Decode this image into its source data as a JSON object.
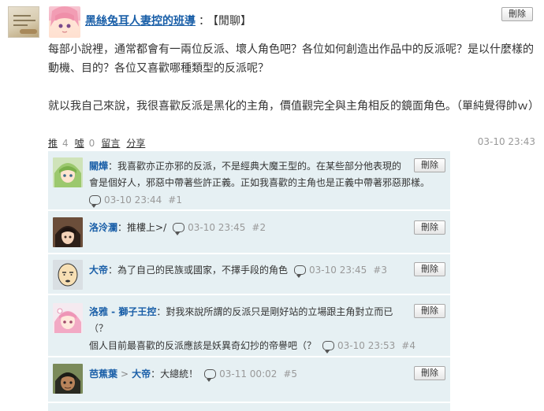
{
  "post": {
    "author": "黑絲兔耳人妻控的班導",
    "separator": "：",
    "topic": "【閒聊】",
    "delete_label": "刪除",
    "body": [
      "每部小說裡，通常都會有一兩位反派、壞人角色吧？各位如何創造出作品中的反派呢？是以什麼樣的動機、目的？各位又喜歡哪種類型的反派呢？",
      "就以我自己來說，我很喜歡反派是黑化的主角，價值觀完全與主角相反的鏡面角色。（單純覺得帥ｗ）"
    ],
    "actions": {
      "push_label": "推",
      "push_count": "4",
      "boo_label": "噓",
      "boo_count": "0",
      "reply_label": "留言",
      "share_label": "分享"
    },
    "time": "03-10 23:43"
  },
  "comments": [
    {
      "author": "關燁",
      "reply_to": "",
      "text_line1": "：我喜歡亦正亦邪的反派，不是經典大魔王型的。在某些部分他表現的",
      "text_line2": "會是個好人，邪惡中帶著些許正義。正如我喜歡的主角也是正義中帶著邪惡那樣。",
      "time": "03-10 23:44",
      "floor": "#1",
      "delete_label": "刪除"
    },
    {
      "author": "洛泠瀾",
      "reply_to": "",
      "text_line1": "：推樓上>/",
      "time": "03-10 23:45",
      "floor": "#2",
      "delete_label": "刪除"
    },
    {
      "author": "大帝",
      "reply_to": "",
      "text_line1": "：為了自己的民族或國家，不擇手段的角色",
      "time": "03-10 23:45",
      "floor": "#3",
      "delete_label": "刪除"
    },
    {
      "author": "洛雅 - 獅子王控",
      "reply_to": "",
      "text_line1": "：對我來說所謂的反派只是剛好站的立場跟主角對立而已",
      "text_line2": "（？",
      "text_line3": "個人目前最喜歡的反派應該是妖異奇幻抄的帝譽吧（？",
      "time": "03-10 23:53",
      "floor": "#4",
      "delete_label": "刪除"
    },
    {
      "author": "芭蕉葉",
      "reply_arrow": ">",
      "reply_to": "大帝",
      "text_line1": "：大總統！",
      "time": "03-11 00:02",
      "floor": "#5",
      "delete_label": "刪除"
    }
  ]
}
